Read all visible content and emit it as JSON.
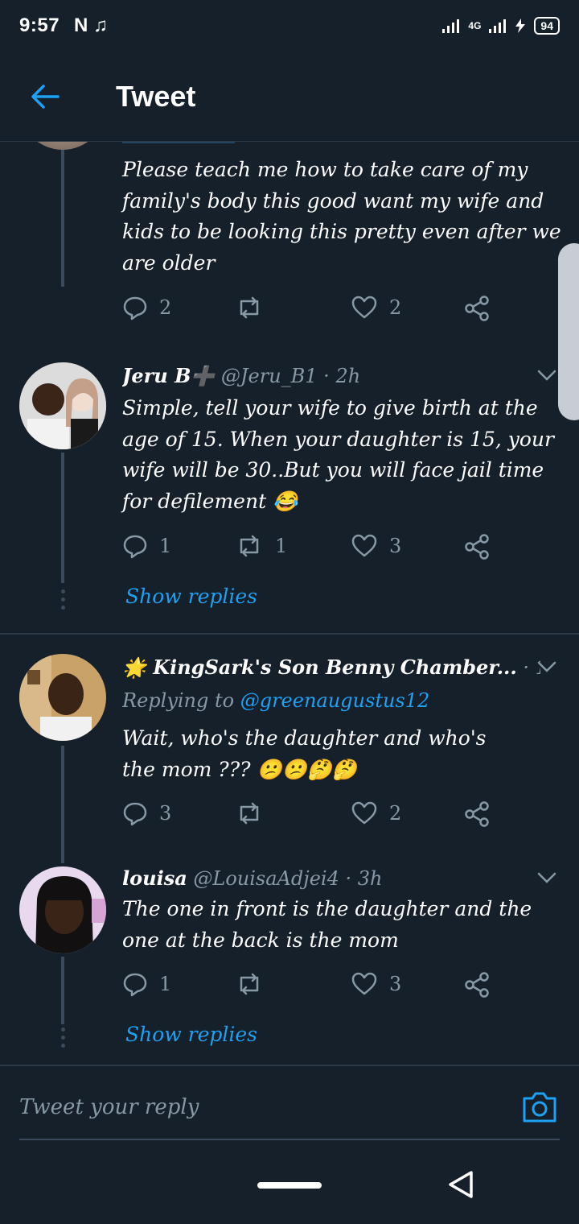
{
  "status_bar": {
    "time": "9:57",
    "left_icons": "N ♫",
    "network": "4G",
    "battery": "94"
  },
  "header": {
    "title": "Tweet"
  },
  "tweets": [
    {
      "text": "Please teach me how to take care of my family's body this good want my wife and kids to be looking this pretty even after we are older",
      "replies": "2",
      "retweets": "",
      "likes": "2"
    },
    {
      "name": "Jeru B➕",
      "handle": "@Jeru_B1 · 2h",
      "text": "Simple, tell your wife to give birth at the age of 15. When your daughter is 15, your wife will be 30..But you will face jail time for defilement 😂",
      "replies": "1",
      "retweets": "1",
      "likes": "3",
      "show_replies": "Show replies"
    },
    {
      "name": "🌟 KingSark's Son Benny Chamber...",
      "handle": "· 12h",
      "replying_prefix": "Replying to ",
      "replying_to": "@greenaugustus12",
      "text": "Wait, who's the daughter and who's the mom ??? 😕😕🤔🤔",
      "replies": "3",
      "retweets": "",
      "likes": "2"
    },
    {
      "name": "louisa",
      "handle": "@LouisaAdjei4 · 3h",
      "text": "The one in front is the daughter and the one at the back is the mom",
      "replies": "1",
      "retweets": "",
      "likes": "3",
      "show_replies": "Show replies"
    }
  ],
  "reply_bar": {
    "placeholder": "Tweet your reply"
  },
  "colors": {
    "background": "#15202b",
    "accent": "#1da1f2",
    "muted": "#8899a6"
  }
}
